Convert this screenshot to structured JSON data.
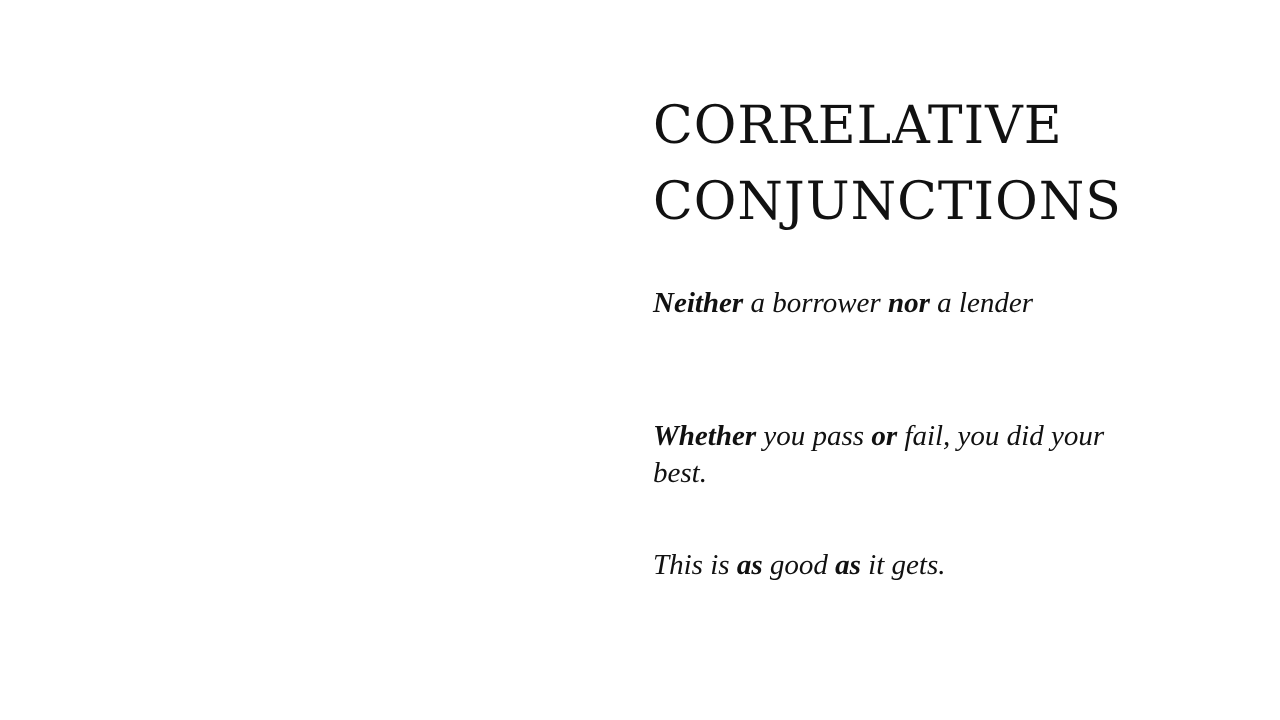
{
  "slide": {
    "title_line1": "CORRELATIVE",
    "title_line2": "CONJUNCTIONS",
    "examples": [
      {
        "parts": [
          {
            "text": "Neither",
            "bold": true
          },
          {
            "text": " a borrower ",
            "bold": false
          },
          {
            "text": "nor",
            "bold": true
          },
          {
            "text": " a lender",
            "bold": false
          }
        ]
      },
      {
        "parts": [
          {
            "text": "Whether",
            "bold": true
          },
          {
            "text": " you pass ",
            "bold": false
          },
          {
            "text": "or",
            "bold": true
          },
          {
            "text": " fail, you did your best.",
            "bold": false
          }
        ]
      },
      {
        "parts": [
          {
            "text": "This is ",
            "bold": false
          },
          {
            "text": "as",
            "bold": true
          },
          {
            "text": " good ",
            "bold": false
          },
          {
            "text": "as",
            "bold": true
          },
          {
            "text": " it gets.",
            "bold": false
          }
        ]
      }
    ]
  }
}
